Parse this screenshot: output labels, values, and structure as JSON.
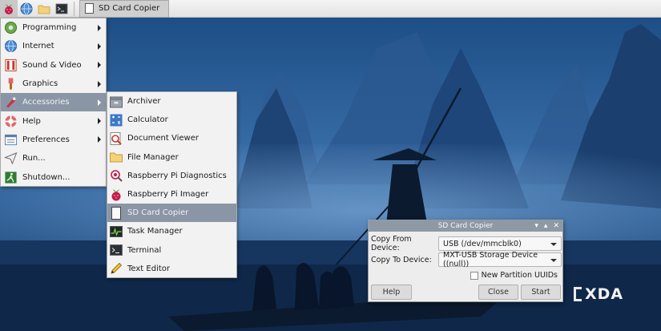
{
  "taskbar": {
    "task_title": "SD Card Copier",
    "launchers": [
      "raspberry-menu-icon",
      "web-browser-icon",
      "file-manager-icon",
      "terminal-icon"
    ]
  },
  "main_menu": {
    "items": [
      {
        "label": "Programming",
        "icon": "programming-icon",
        "submenu": true
      },
      {
        "label": "Internet",
        "icon": "globe-icon",
        "submenu": true
      },
      {
        "label": "Sound & Video",
        "icon": "sound-video-icon",
        "submenu": true
      },
      {
        "label": "Graphics",
        "icon": "graphics-icon",
        "submenu": true
      },
      {
        "label": "Accessories",
        "icon": "accessories-icon",
        "submenu": true,
        "highlighted": true
      },
      {
        "label": "Help",
        "icon": "help-icon",
        "submenu": true
      },
      {
        "label": "Preferences",
        "icon": "preferences-icon",
        "submenu": true
      },
      {
        "label": "Run...",
        "icon": "run-icon",
        "submenu": false
      },
      {
        "label": "Shutdown...",
        "icon": "shutdown-icon",
        "submenu": false
      }
    ]
  },
  "accessories_menu": {
    "items": [
      {
        "label": "Archiver",
        "icon": "archiver-icon"
      },
      {
        "label": "Calculator",
        "icon": "calculator-icon"
      },
      {
        "label": "Document Viewer",
        "icon": "document-viewer-icon"
      },
      {
        "label": "File Manager",
        "icon": "folder-icon"
      },
      {
        "label": "Raspberry Pi Diagnostics",
        "icon": "diagnostics-icon"
      },
      {
        "label": "Raspberry Pi Imager",
        "icon": "raspberry-icon"
      },
      {
        "label": "SD Card Copier",
        "icon": "sd-card-icon",
        "highlighted": true
      },
      {
        "label": "Task Manager",
        "icon": "task-manager-icon"
      },
      {
        "label": "Terminal",
        "icon": "terminal-icon"
      },
      {
        "label": "Text Editor",
        "icon": "text-editor-icon"
      }
    ]
  },
  "dialog": {
    "title": "SD Card Copier",
    "copy_from_label": "Copy From Device:",
    "copy_from_value": "USB  (/dev/mmcblk0)",
    "copy_to_label": "Copy To Device:",
    "copy_to_value": "MXT-USB Storage Device  ((null))",
    "checkbox_label": "New Partition UUIDs",
    "checkbox_checked": false,
    "help_label": "Help",
    "close_label": "Close",
    "start_label": "Start",
    "controls": {
      "minimize": "▾",
      "maximize": "▴",
      "close": "✕"
    }
  },
  "watermark": {
    "text": "XDA"
  },
  "colors": {
    "menu_highlight": "#8a96a5",
    "dialog_title": "#8e99a6",
    "sky": "#1f4f8a",
    "mountains": "#163a66"
  }
}
